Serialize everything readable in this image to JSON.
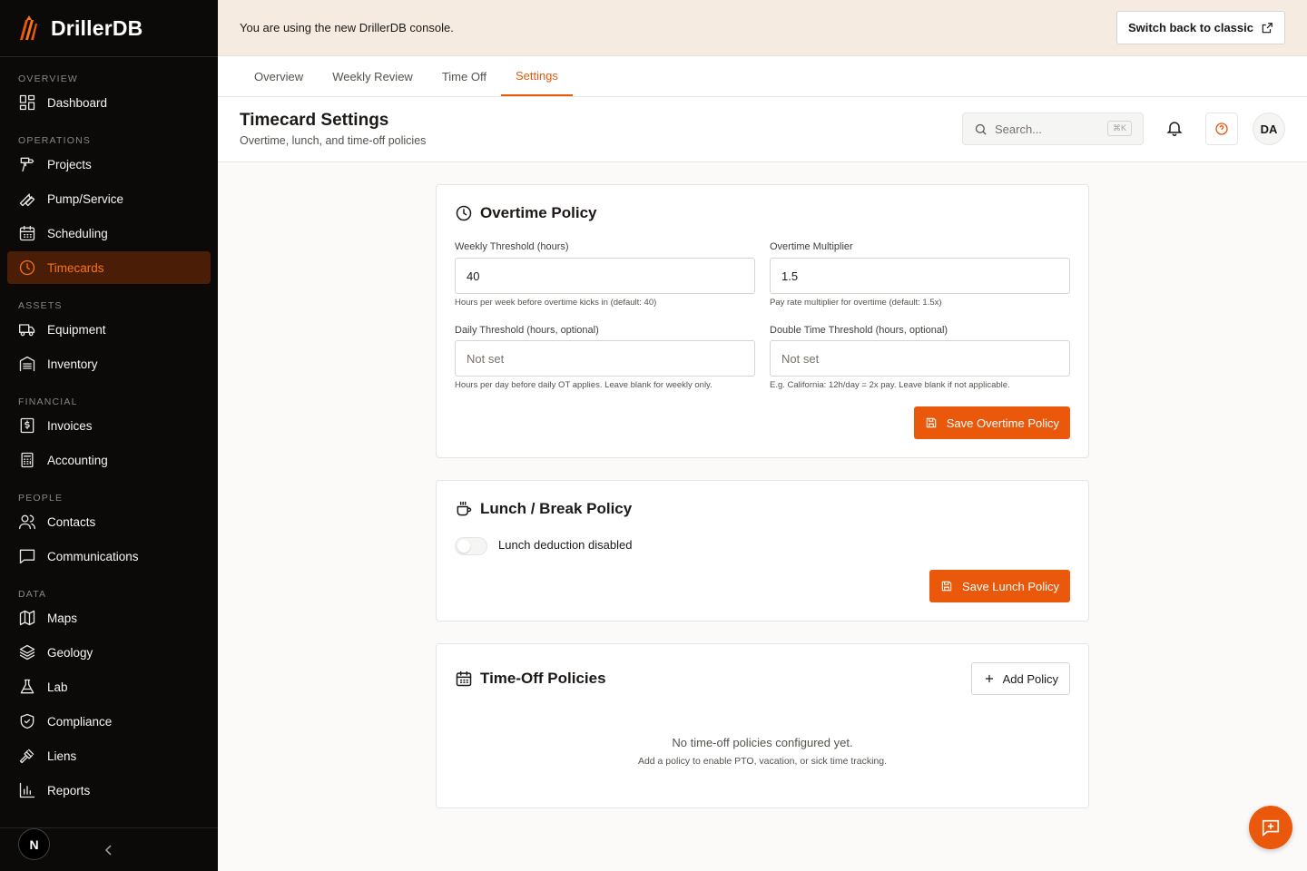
{
  "brand": {
    "name": "DrillerDB"
  },
  "sidebar": {
    "sections": [
      {
        "label": "OVERVIEW",
        "items": [
          {
            "label": "Dashboard",
            "icon": "dashboard-icon"
          }
        ]
      },
      {
        "label": "OPERATIONS",
        "items": [
          {
            "label": "Projects",
            "icon": "drill-icon"
          },
          {
            "label": "Pump/Service",
            "icon": "wrench-icon"
          },
          {
            "label": "Scheduling",
            "icon": "calendar-icon"
          },
          {
            "label": "Timecards",
            "icon": "clock-icon",
            "active": true
          }
        ]
      },
      {
        "label": "ASSETS",
        "items": [
          {
            "label": "Equipment",
            "icon": "truck-icon"
          },
          {
            "label": "Inventory",
            "icon": "warehouse-icon"
          }
        ]
      },
      {
        "label": "FINANCIAL",
        "items": [
          {
            "label": "Invoices",
            "icon": "invoice-icon"
          },
          {
            "label": "Accounting",
            "icon": "calculator-icon"
          }
        ]
      },
      {
        "label": "PEOPLE",
        "items": [
          {
            "label": "Contacts",
            "icon": "users-icon"
          },
          {
            "label": "Communications",
            "icon": "message-icon"
          }
        ]
      },
      {
        "label": "DATA",
        "items": [
          {
            "label": "Maps",
            "icon": "map-icon"
          },
          {
            "label": "Geology",
            "icon": "layers-icon"
          },
          {
            "label": "Lab",
            "icon": "flask-icon"
          },
          {
            "label": "Compliance",
            "icon": "shield-icon"
          },
          {
            "label": "Liens",
            "icon": "gavel-icon"
          },
          {
            "label": "Reports",
            "icon": "chart-icon"
          }
        ]
      }
    ],
    "footer_badge": "N"
  },
  "banner": {
    "text": "You are using the new DrillerDB console.",
    "button": "Switch back to classic"
  },
  "tabs": [
    {
      "label": "Overview"
    },
    {
      "label": "Weekly Review"
    },
    {
      "label": "Time Off"
    },
    {
      "label": "Settings",
      "active": true
    }
  ],
  "header": {
    "title": "Timecard Settings",
    "subtitle": "Overtime, lunch, and time-off policies",
    "search_placeholder": "Search...",
    "search_shortcut": "⌘K",
    "avatar": "DA"
  },
  "overtime": {
    "title": "Overtime Policy",
    "weekly_label": "Weekly Threshold (hours)",
    "weekly_value": "40",
    "weekly_help": "Hours per week before overtime kicks in (default: 40)",
    "multiplier_label": "Overtime Multiplier",
    "multiplier_value": "1.5",
    "multiplier_help": "Pay rate multiplier for overtime (default: 1.5x)",
    "daily_label": "Daily Threshold (hours, optional)",
    "daily_placeholder": "Not set",
    "daily_help": "Hours per day before daily OT applies. Leave blank for weekly only.",
    "double_label": "Double Time Threshold (hours, optional)",
    "double_placeholder": "Not set",
    "double_help": "E.g. California: 12h/day = 2x pay. Leave blank if not applicable.",
    "save_button": "Save Overtime Policy"
  },
  "lunch": {
    "title": "Lunch / Break Policy",
    "toggle_label": "Lunch deduction disabled",
    "toggle_on": false,
    "save_button": "Save Lunch Policy"
  },
  "timeoff": {
    "title": "Time-Off Policies",
    "add_button": "Add Policy",
    "empty_title": "No time-off policies configured yet.",
    "empty_sub": "Add a policy to enable PTO, vacation, or sick time tracking."
  },
  "colors": {
    "accent": "#ea580c",
    "sidebar_bg": "#0c0a09",
    "banner_bg": "#f5ebe0"
  }
}
